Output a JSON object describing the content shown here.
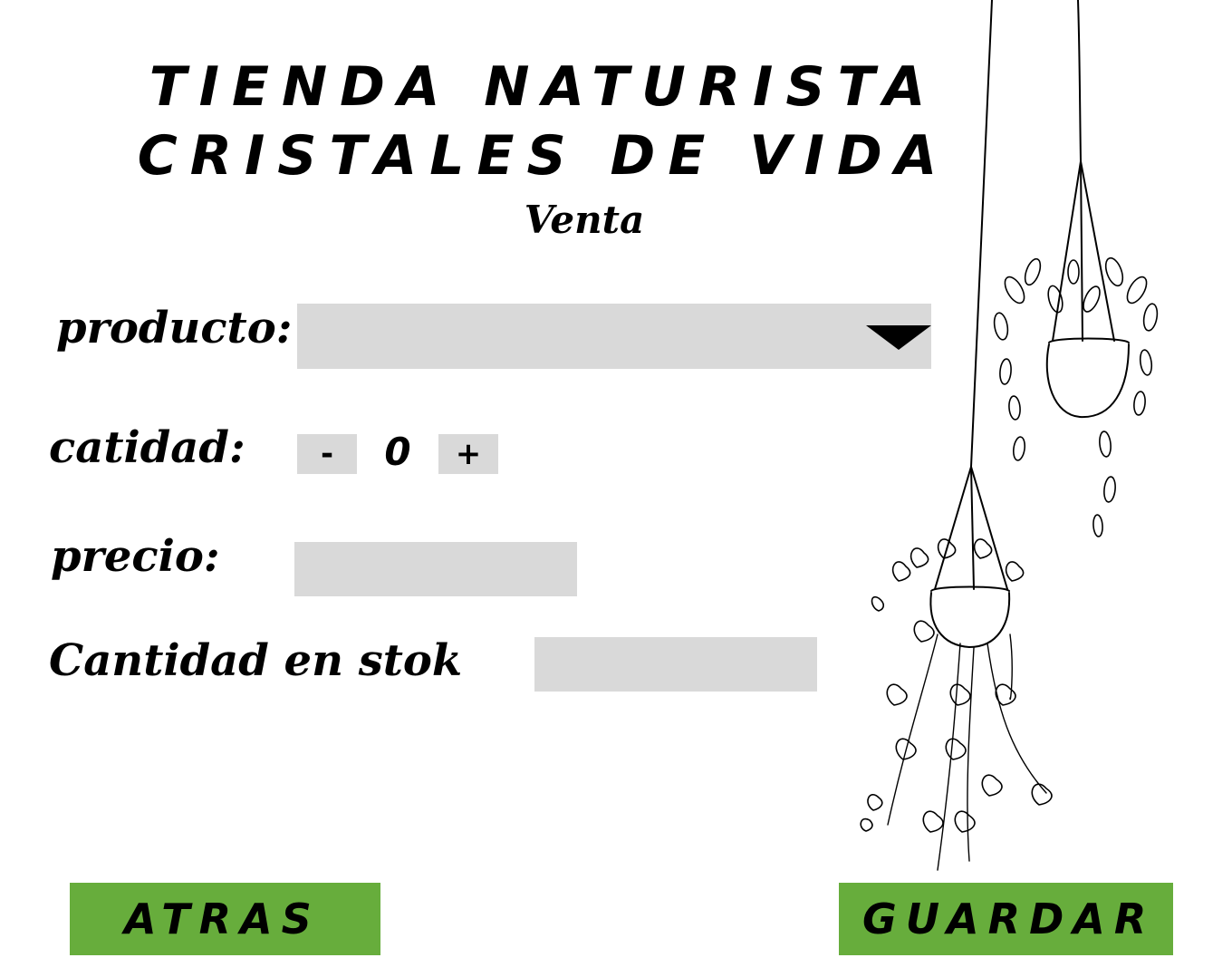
{
  "header": {
    "title_line_1": "TIENDA NATURISTA",
    "title_line_2": "CRISTALES DE VIDA",
    "subtitle": "Venta"
  },
  "form": {
    "producto_label": "producto:",
    "producto_value": "",
    "cantidad_label": "catidad:",
    "cantidad_minus": "-",
    "cantidad_value": "0",
    "cantidad_plus": "+",
    "precio_label": "precio:",
    "precio_value": "",
    "stock_label": "Cantidad en stok",
    "stock_value": ""
  },
  "actions": {
    "back_label": "ATRAS",
    "save_label": "GUARDAR"
  },
  "colors": {
    "button_green": "#67ad3c",
    "field_gray": "#d9d9d9"
  },
  "icons": {
    "dropdown": "chevron-down-icon",
    "illustration": "hanging-plants-illustration"
  }
}
